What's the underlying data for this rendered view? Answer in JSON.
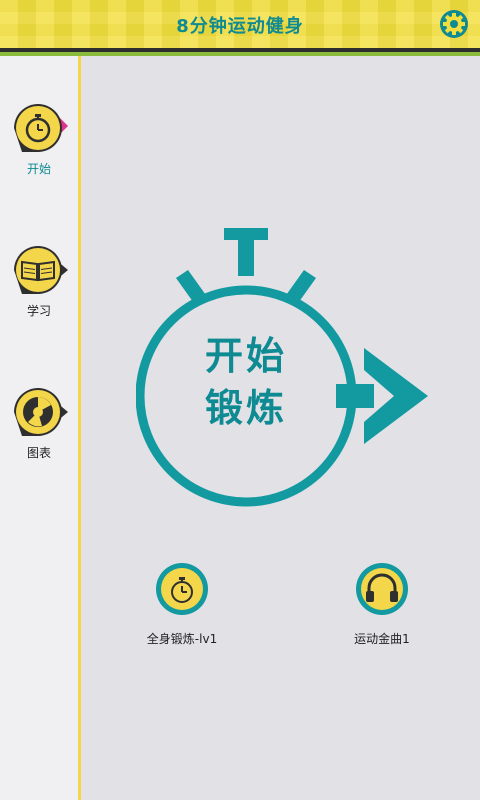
{
  "header": {
    "title": "8分钟运动健身",
    "settings_icon": "gear-icon"
  },
  "sidebar": {
    "items": [
      {
        "label": "开始",
        "icon": "stopwatch-icon",
        "active": true
      },
      {
        "label": "学习",
        "icon": "book-icon",
        "active": false
      },
      {
        "label": "图表",
        "icon": "chart-icon",
        "active": false
      }
    ]
  },
  "main": {
    "start_line1": "开始",
    "start_line2": "锻炼",
    "bottom_left_label": "全身锻炼-lv1",
    "bottom_right_label": "运动金曲1"
  },
  "colors": {
    "accent": "#0e8a92",
    "yellow": "#f2df3e",
    "background": "#e1e1e6"
  }
}
